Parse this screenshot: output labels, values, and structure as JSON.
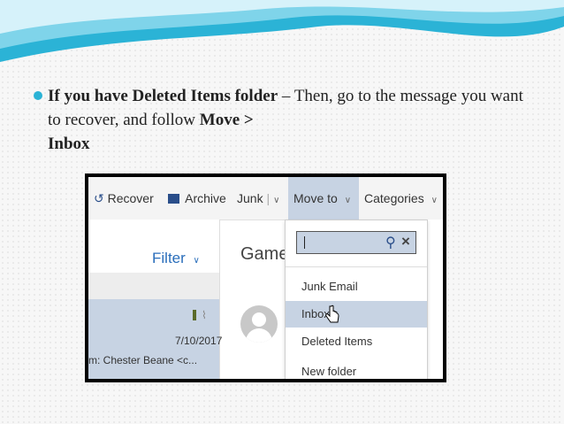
{
  "bullet": {
    "bold_lead": "If you have Deleted Items folder",
    "rest_1": " – Then, go to the message you want to recover, and follow ",
    "bold_move": "Move >",
    "bold_inbox": "Inbox"
  },
  "toolbar": {
    "recover": "Recover",
    "archive": "Archive",
    "junk": "Junk",
    "move_to": "Move to",
    "categories": "Categories"
  },
  "left_pane": {
    "filter": "Filter",
    "date": "7/10/2017",
    "from": "m: Chester Beane <c..."
  },
  "reading": {
    "subject": "Game"
  },
  "move_menu": {
    "items": [
      "Junk Email",
      "Inbox",
      "Deleted Items",
      "New folder"
    ],
    "highlighted": "Inbox"
  },
  "colors": {
    "accent": "#2bb3d6",
    "selection": "#c7d3e3",
    "link": "#2a6ebb"
  }
}
